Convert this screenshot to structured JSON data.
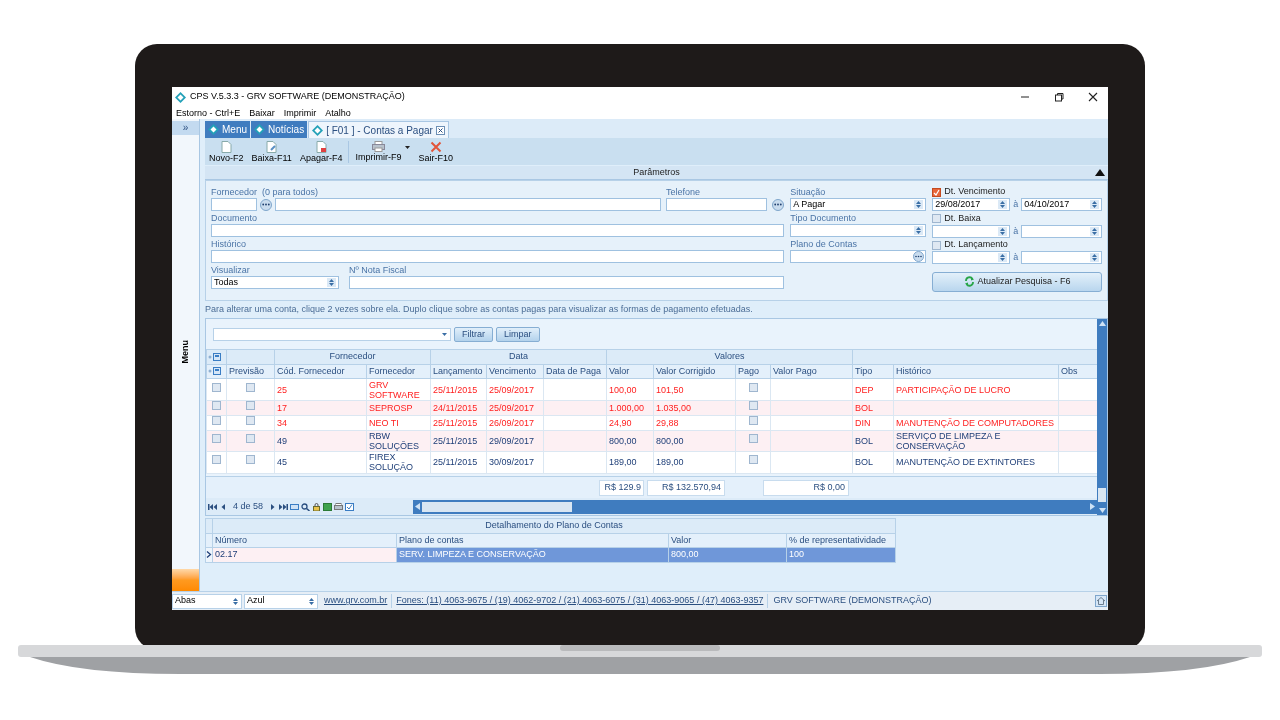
{
  "window": {
    "title": "CPS V.5.3.3 - GRV SOFTWARE (DEMONSTRAÇÃO)"
  },
  "menu_bar": [
    "Estorno - Ctrl+E",
    "Baixar",
    "Imprimir",
    "Atalho"
  ],
  "sidebar": {
    "toggle": "»",
    "label": "Menu"
  },
  "tabs": [
    {
      "label": "Menu",
      "selected": false,
      "closable": false
    },
    {
      "label": "Notícias",
      "selected": false,
      "closable": false
    },
    {
      "label": "[ F01 ] - Contas a Pagar",
      "selected": true,
      "closable": true
    }
  ],
  "toolbar": [
    {
      "label": "Novo-F2",
      "kind": "new",
      "dropdown": false
    },
    {
      "label": "Baixa-F11",
      "kind": "edit",
      "dropdown": false
    },
    {
      "label": "Apagar-F4",
      "kind": "delete",
      "dropdown": false
    },
    {
      "label": "Imprimir-F9",
      "kind": "print",
      "dropdown": true
    },
    {
      "label": "Sair-F10",
      "kind": "exit",
      "dropdown": false
    }
  ],
  "parameters": {
    "title": "Parâmetros",
    "fornecedor": {
      "label": "Fornecedor  (0 para todos)"
    },
    "telefone": {
      "label": "Telefone"
    },
    "documento": {
      "label": "Documento"
    },
    "historico": {
      "label": "Histórico"
    },
    "visualizar": {
      "label": "Visualizar",
      "value": "Todas"
    },
    "nota_fiscal": {
      "label": "Nº Nota Fiscal"
    },
    "situacao": {
      "label": "Situação",
      "value": "A Pagar"
    },
    "tipo_documento": {
      "label": "Tipo Documento"
    },
    "plano_de_contas": {
      "label": "Plano de Contas"
    },
    "date_filters": [
      {
        "label": "Dt. Vencimento",
        "checked": true,
        "from": "29/08/2017",
        "separator": "à",
        "to": "04/10/2017"
      },
      {
        "label": "Dt. Baixa",
        "checked": false,
        "separator": "à"
      },
      {
        "label": "Dt. Lançamento",
        "checked": false,
        "separator": "à"
      }
    ],
    "refresh_button": "Atualizar Pesquisa - F6"
  },
  "hint": "Para alterar uma conta, clique 2 vezes sobre ela. Duplo clique sobre as contas pagas para visualizar as formas de pagamento efetuadas.",
  "filter_buttons": [
    "Filtrar",
    "Limpar"
  ],
  "grid": {
    "groups": [
      {
        "label": "Fornecedor"
      },
      {
        "label": "Data"
      },
      {
        "label": "Valores"
      }
    ],
    "columns": [
      "Previsão",
      "Cód. Fornecedor",
      "Fornecedor",
      "Lançamento",
      "Vencimento",
      "Data de Paga",
      "Valor",
      "Valor Corrigido",
      "Pago",
      "Valor Pago",
      "Tipo",
      "Histórico",
      "Obs"
    ],
    "rows": [
      {
        "overdue": true,
        "marked": false,
        "previsao": false,
        "pago": false,
        "codigo": "25",
        "fornecedor": "GRV SOFTWARE",
        "lancamento": "25/11/2015",
        "vencimento": "25/09/2017",
        "valor": "100,00",
        "valor_corrigido": "101,50",
        "tipo": "DEP",
        "historico": "PARTICIPAÇÃO DE LUCRO"
      },
      {
        "overdue": true,
        "marked": false,
        "previsao": false,
        "pago": false,
        "codigo": "17",
        "fornecedor": "SEPROSP",
        "lancamento": "24/11/2015",
        "vencimento": "25/09/2017",
        "valor": "1.000,00",
        "valor_corrigido": "1.035,00",
        "tipo": "BOL"
      },
      {
        "overdue": true,
        "marked": false,
        "previsao": false,
        "pago": false,
        "codigo": "34",
        "fornecedor": "NEO TI",
        "lancamento": "25/11/2015",
        "vencimento": "26/09/2017",
        "valor": "24,90",
        "valor_corrigido": "29,88",
        "tipo": "DIN",
        "historico": "MANUTENÇÃO DE COMPUTADORES"
      },
      {
        "overdue": false,
        "marked": false,
        "previsao": false,
        "pago": false,
        "codigo": "49",
        "fornecedor": "RBW SOLUÇÕES",
        "lancamento": "25/11/2015",
        "vencimento": "29/09/2017",
        "valor": "800,00",
        "valor_corrigido": "800,00",
        "tipo": "BOL",
        "historico": "SERVIÇO DE LIMPEZA E CONSERVAÇÃO"
      },
      {
        "overdue": false,
        "marked": false,
        "previsao": false,
        "pago": false,
        "codigo": "45",
        "fornecedor": "FIREX SOLUÇÃO",
        "lancamento": "25/11/2015",
        "vencimento": "30/09/2017",
        "valor": "189,00",
        "valor_corrigido": "189,00",
        "tipo": "BOL",
        "historico": "MANUTENÇÃO DE EXTINTORES"
      }
    ],
    "totals": {
      "valor": "R$ 129.9",
      "valor_corrigido": "R$ 132.570,94",
      "valor_pago": "R$ 0,00"
    },
    "position": "4 de 58"
  },
  "details": {
    "title": "Detalhamento do Plano de Contas",
    "columns": [
      "Número",
      "Plano de contas",
      "Valor",
      "% de representatividade"
    ],
    "rows": [
      {
        "selected": true,
        "cells": [
          "02.17",
          "SERV. LIMPEZA E CONSERVAÇÃO",
          "800,00",
          "100"
        ]
      }
    ]
  },
  "status_bar": {
    "layout": "Abas",
    "theme": "Azul",
    "website": "www.grv.com.br",
    "phones": "Fones: (11) 4063-9675 / (19) 4062-9702 / (21) 4063-6075 / (31) 4063-9065 / (47) 4063-9357",
    "company": "GRV SOFTWARE (DEMONSTRAÇÃO)"
  }
}
